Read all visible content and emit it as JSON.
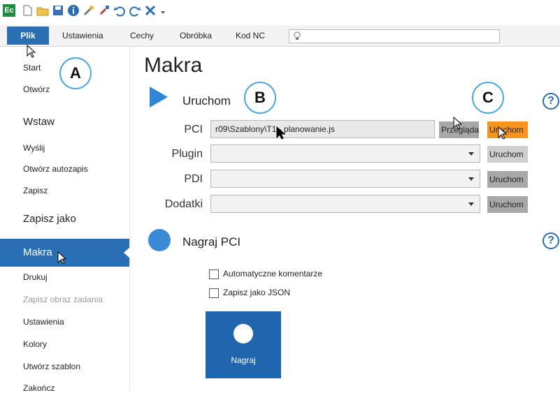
{
  "app": {
    "logo": "Ec",
    "accent": "#2a6fb4",
    "orange": "#f7941d"
  },
  "menu": {
    "file": "Plik",
    "items": [
      "Ustawienia",
      "Cechy",
      "Obróbka",
      "Kod NC"
    ]
  },
  "sidebar": {
    "items": [
      "Start",
      "Otwórz",
      "Wstaw",
      "Wyślij",
      "Otwórz autozapis",
      "Zapisz",
      "Zapisz jako",
      "Makra",
      "Drukuj",
      "Zapisz obraz zadania",
      "Ustawienia",
      "Kolory",
      "Utwórz szablon",
      "Zakończ"
    ]
  },
  "main": {
    "title": "Makra",
    "run_section": {
      "title": "Uruchom"
    },
    "rows": {
      "pci": {
        "label": "PCI",
        "value": "r09\\Szablony\\T1 - planowanie.js",
        "browse": "Przeglądaj",
        "run": "Uruchom"
      },
      "plugin": {
        "label": "Plugin",
        "run": "Uruchom"
      },
      "pdi": {
        "label": "PDI",
        "run": "Uruchom"
      },
      "addons": {
        "label": "Dodatki",
        "run": "Uruchom"
      }
    },
    "record_section": {
      "title": "Nagraj PCI",
      "opt1": "Automatyczne komentarze",
      "opt2": "Zapisz jako JSON",
      "record": "Nagraj"
    },
    "help": "?"
  },
  "callouts": {
    "a": "A",
    "b": "B",
    "c": "C"
  }
}
